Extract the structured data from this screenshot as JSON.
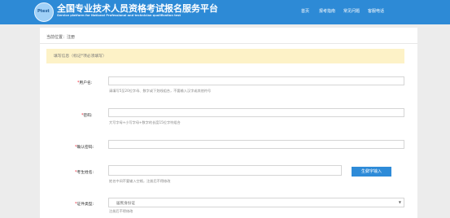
{
  "header": {
    "logo_text": "Ptest",
    "title": "全国专业技术人员资格考试报名服务平台",
    "subtitle": "Service platform for National Professional and technician qualification test",
    "nav": [
      "首页",
      "报考指南",
      "常见问题",
      "客服电话"
    ]
  },
  "breadcrumb": "当前位置：注册",
  "notice": "填写信息（标记*项必须填写）",
  "form": {
    "username": {
      "label": "用户名:",
      "hint": "请填写5至20位字母、数字或下划线组合，不要输入汉字或其他符号"
    },
    "password": {
      "label": "密码:",
      "hint": "大写字母+小写字母+数字的长度15位字符组合"
    },
    "confirm_password": {
      "label": "确认密码:"
    },
    "name": {
      "label": "考生姓名:",
      "hint": "姓名中间不要输入空格，注册后不得修改",
      "button": "生僻字输入"
    },
    "id_type": {
      "label": "证件类型:",
      "value": "居民身份证",
      "hint": "注册后不得修改"
    }
  }
}
